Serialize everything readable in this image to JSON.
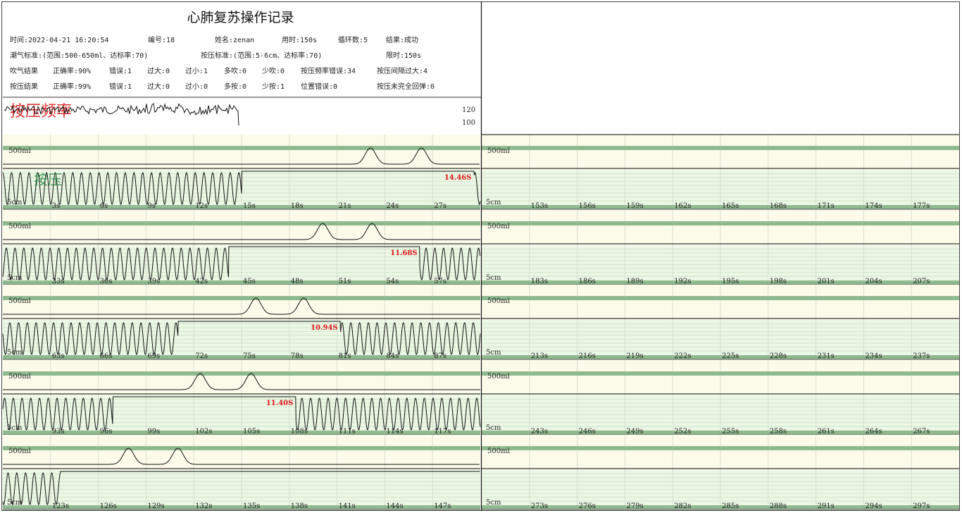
{
  "header": {
    "title": "心肺复苏操作记录",
    "rows": [
      [
        "时间:2022-04-21 16:20:54",
        "编号:18",
        "姓名:zenan",
        "用时:150s",
        "循环数:5",
        "结果:成功"
      ],
      [
        "潮气标准:(范围:500-650ml、达标率:70)",
        "按压标准:(范围:5-6cm、达标率:70)",
        "限时:150s"
      ],
      [
        "吹气结果",
        "正确率:90%",
        "错误:1",
        "过大:0",
        "过小:1",
        "多吹:0",
        "少吹:0",
        "按压频率错误:34",
        "按压间隔过大:4"
      ],
      [
        "按压结果",
        "正确率:99%",
        "错误:1",
        "过大:0",
        "过小:0",
        "多按:0",
        "少按:1",
        "位置错误:0",
        "按压未完全回弹:0"
      ]
    ]
  },
  "freq_panel": {
    "label": "按压频率",
    "ticks": [
      "120",
      "100"
    ]
  },
  "labels": {
    "breath_ref": "500ml",
    "depth_ref": "5cm",
    "compress": "按压"
  },
  "colors": {
    "band": "#8fb98f",
    "breath_bg": "#fcfbea",
    "compress_bg": "#ecf7e6",
    "pause_label": "#e0161a",
    "freq_label": "#e03030",
    "compress_label": "#2e8a4a"
  },
  "chart_data": {
    "type": "line",
    "x_unit": "s",
    "y_units": {
      "breath": "ml",
      "depth": "cm",
      "freq": "次/分"
    },
    "freq_curve_end_s": 150,
    "rows": [
      {
        "x_range": [
          0,
          30
        ],
        "ticks": [
          "3s",
          "6s",
          "9s",
          "12s",
          "15s",
          "18s",
          "21s",
          "24s",
          "27s"
        ],
        "compress_active": [
          [
            0,
            15
          ],
          [
            29.6,
            30
          ]
        ],
        "breaths": [
          23.1,
          26.3
        ],
        "pause_label": "14.46S"
      },
      {
        "x_range": [
          30,
          60
        ],
        "ticks": [
          "33s",
          "36s",
          "39s",
          "42s",
          "45s",
          "48s",
          "51s",
          "54s",
          "57s"
        ],
        "compress_active": [
          [
            30,
            44.2
          ],
          [
            56.2,
            60
          ]
        ],
        "breaths": [
          50.1,
          53.2
        ],
        "pause_label": "11.68S"
      },
      {
        "x_range": [
          60,
          90
        ],
        "ticks": [
          "63s",
          "66s",
          "69s",
          "72s",
          "75s",
          "78s",
          "81s",
          "84s",
          "87s"
        ],
        "compress_active": [
          [
            60,
            71
          ],
          [
            81.2,
            90
          ]
        ],
        "breaths": [
          75.9,
          78.9
        ],
        "pause_label": "10.94S"
      },
      {
        "x_range": [
          90,
          120
        ],
        "ticks": [
          "93s",
          "96s",
          "99s",
          "102s",
          "105s",
          "108s",
          "111s",
          "114s",
          "117s"
        ],
        "compress_active": [
          [
            90,
            96.9
          ],
          [
            108.4,
            120
          ]
        ],
        "breaths": [
          102.4,
          105.6
        ],
        "pause_label": "11.40S"
      },
      {
        "x_range": [
          120,
          150
        ],
        "ticks": [
          "123s",
          "126s",
          "129s",
          "132s",
          "135s",
          "138s",
          "141s",
          "144s",
          "147s"
        ],
        "compress_active": [
          [
            120,
            123.6
          ]
        ],
        "breaths": [
          127.9,
          131
        ]
      },
      {
        "x_range": [
          150,
          180
        ],
        "ticks": [
          "153s",
          "156s",
          "159s",
          "162s",
          "165s",
          "168s",
          "171s",
          "174s",
          "177s"
        ],
        "compress_active": [],
        "breaths": []
      },
      {
        "x_range": [
          180,
          210
        ],
        "ticks": [
          "183s",
          "186s",
          "189s",
          "192s",
          "195s",
          "198s",
          "201s",
          "204s",
          "207s"
        ],
        "compress_active": [],
        "breaths": []
      },
      {
        "x_range": [
          210,
          240
        ],
        "ticks": [
          "213s",
          "216s",
          "219s",
          "222s",
          "225s",
          "228s",
          "231s",
          "234s",
          "237s"
        ],
        "compress_active": [],
        "breaths": []
      },
      {
        "x_range": [
          240,
          270
        ],
        "ticks": [
          "243s",
          "246s",
          "249s",
          "252s",
          "255s",
          "258s",
          "261s",
          "264s",
          "267s"
        ],
        "compress_active": [],
        "breaths": []
      },
      {
        "x_range": [
          270,
          300
        ],
        "ticks": [
          "273s",
          "276s",
          "279s",
          "282s",
          "285s",
          "288s",
          "291s",
          "294s",
          "297s"
        ],
        "compress_active": [],
        "breaths": []
      }
    ]
  }
}
